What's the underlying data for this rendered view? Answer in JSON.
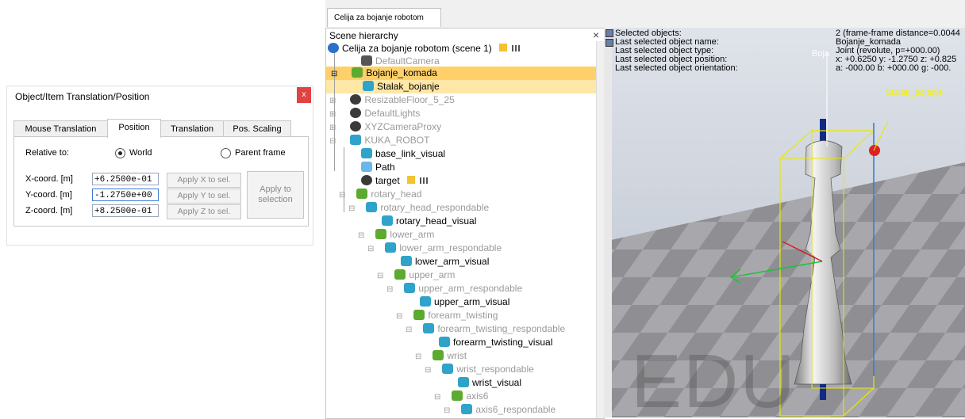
{
  "dialog": {
    "title": "Object/Item Translation/Position",
    "close": "x",
    "tabs": [
      "Mouse Translation",
      "Position",
      "Translation",
      "Pos. Scaling"
    ],
    "relative_to_label": "Relative to:",
    "radio_world": "World",
    "radio_parent": "Parent frame",
    "x_label": "X-coord. [m]",
    "y_label": "Y-coord. [m]",
    "z_label": "Z-coord. [m]",
    "x_value": "+6.2500e-01",
    "y_value": "-1.2750e+00",
    "z_value": "+8.2500e-01",
    "apply_x": "Apply X to sel.",
    "apply_y": "Apply Y to sel.",
    "apply_z": "Apply Z to sel.",
    "apply_selection": "Apply to selection"
  },
  "app": {
    "doc_tab": "Celija za bojanje robotom",
    "hierarchy_title": "Scene hierarchy",
    "hierarchy_close": "×",
    "tree": [
      {
        "label": "Celija za bojanje robotom (scene 1)",
        "dim": false
      },
      {
        "label": "DefaultCamera",
        "dim": true
      },
      {
        "label": "Bojanje_komada",
        "dim": false
      },
      {
        "label": "Stalak_bojanje",
        "dim": false
      },
      {
        "label": "ResizableFloor_5_25",
        "dim": true
      },
      {
        "label": "DefaultLights",
        "dim": true
      },
      {
        "label": "XYZCameraProxy",
        "dim": true
      },
      {
        "label": "KUKA_ROBOT",
        "dim": true
      },
      {
        "label": "base_link_visual",
        "dim": false
      },
      {
        "label": "Path",
        "dim": false
      },
      {
        "label": "target",
        "dim": false
      },
      {
        "label": "rotary_head",
        "dim": true
      },
      {
        "label": "rotary_head_respondable",
        "dim": true
      },
      {
        "label": "rotary_head_visual",
        "dim": false
      },
      {
        "label": "lower_arm",
        "dim": true
      },
      {
        "label": "lower_arm_respondable",
        "dim": true
      },
      {
        "label": "lower_arm_visual",
        "dim": false
      },
      {
        "label": "upper_arm",
        "dim": true
      },
      {
        "label": "upper_arm_respondable",
        "dim": true
      },
      {
        "label": "upper_arm_visual",
        "dim": false
      },
      {
        "label": "forearm_twisting",
        "dim": true
      },
      {
        "label": "forearm_twisting_respondable",
        "dim": true
      },
      {
        "label": "forearm_twisting_visual",
        "dim": false
      },
      {
        "label": "wrist",
        "dim": true
      },
      {
        "label": "wrist_respondable",
        "dim": true
      },
      {
        "label": "wrist_visual",
        "dim": false
      },
      {
        "label": "axis6",
        "dim": true
      },
      {
        "label": "axis6_respondable",
        "dim": true
      }
    ],
    "info_labels": [
      "Selected objects:",
      "Last selected object name:",
      "Last selected object type:",
      "Last selected object position:",
      "Last selected object orientation:"
    ],
    "info_values": [
      "2 (frame-frame distance=0.0044",
      "Bojanje_komada",
      "Joint (revolute, p=+000.00)",
      "x: +0.6250   y: -1.2750   z: +0.825",
      "a: -000.00   b: +000.00   g: -000."
    ],
    "viewport_label_small": "Boja",
    "viewport_label_stalak": "Stalak_bojanje",
    "watermark": "EDU"
  }
}
